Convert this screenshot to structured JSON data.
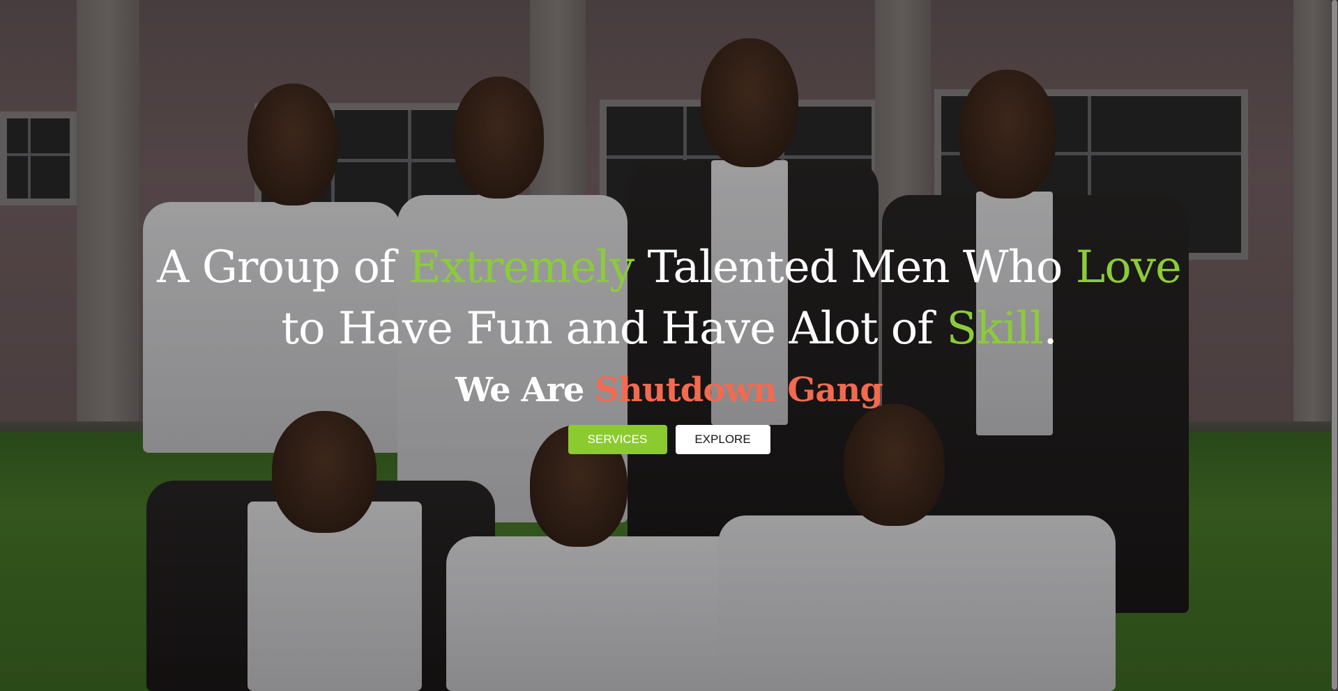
{
  "hero": {
    "headline": {
      "part1": "A Group of ",
      "highlight1": "Extremely",
      "part2": " Talented Men Who ",
      "highlight2": "Love",
      "part3": " to Have Fun and Have Alot of ",
      "highlight3": "Skill",
      "part4": "."
    },
    "subhead": {
      "prefix": "We Are ",
      "name": "Shutdown Gang"
    },
    "actions": {
      "services_label": "SERVICES",
      "explore_label": "EXPLORE"
    }
  },
  "colors": {
    "accent_green": "#8ccb3a",
    "accent_red": "#f26a4f",
    "services_button": "#8ccb2f",
    "explore_button": "#ffffff"
  }
}
